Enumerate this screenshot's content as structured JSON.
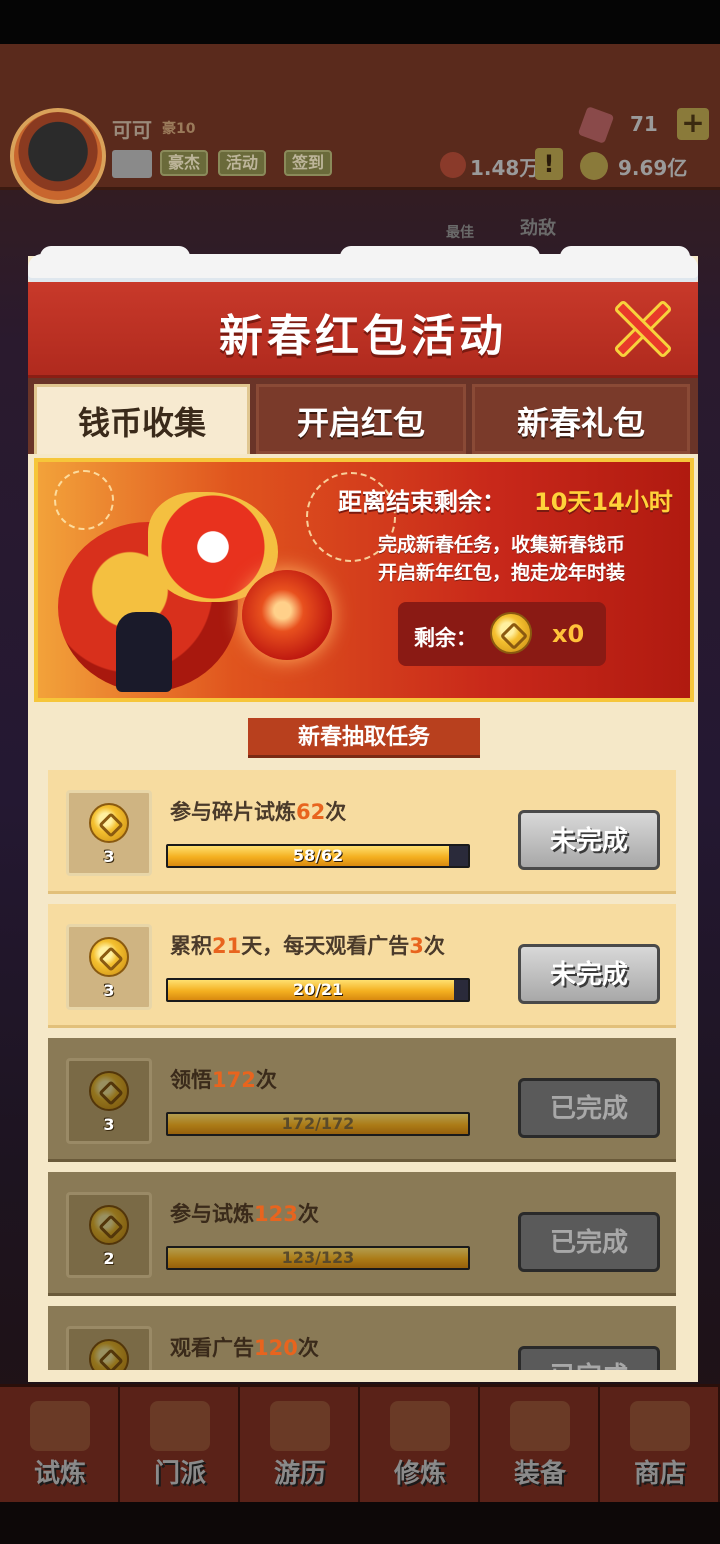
{
  "background": {
    "player": {
      "name": "可可",
      "rank": "豪10"
    },
    "hud_buttons": [
      "豪杰",
      "活动",
      "签到"
    ],
    "gems": "71",
    "resource_1": "1.48万",
    "resource_2": "9.69亿",
    "label_best": "最佳",
    "label_enemy": "劲敌",
    "nav": [
      {
        "label": "试炼",
        "icon": "scroll-icon"
      },
      {
        "label": "门派",
        "icon": "temple-icon"
      },
      {
        "label": "游历",
        "icon": "mountain-icon"
      },
      {
        "label": "修炼",
        "icon": "book-icon"
      },
      {
        "label": "装备",
        "icon": "sword-icon"
      },
      {
        "label": "商店",
        "icon": "shop-icon"
      }
    ]
  },
  "modal": {
    "title": "新春红包活动",
    "tabs": [
      {
        "label": "钱币收集",
        "active": true
      },
      {
        "label": "开启红包",
        "active": false
      },
      {
        "label": "新春礼包",
        "active": false
      }
    ],
    "banner": {
      "timer_label": "距离结束剩余：",
      "timer_value": "10天14小时",
      "desc_line1": "完成新春任务，收集新春钱币",
      "desc_line2": "开启新年红包，抱走龙年时装",
      "remain_label": "剩余：",
      "remain_count": "x0"
    },
    "section_title": "新春抽取任务",
    "tasks": [
      {
        "pre": "参与碎片试炼",
        "num": "62",
        "post": "次",
        "reward": "3",
        "progress": "58/62",
        "fraction": 0.935,
        "status": "未完成",
        "done": false
      },
      {
        "pre": "累积",
        "num": "21",
        "post": "天，每天观看广告",
        "num2": "3",
        "post2": "次",
        "reward": "3",
        "progress": "20/21",
        "fraction": 0.952,
        "status": "未完成",
        "done": false
      },
      {
        "pre": "领悟",
        "num": "172",
        "post": "次",
        "reward": "3",
        "progress": "172/172",
        "fraction": 1.0,
        "status": "已完成",
        "done": true
      },
      {
        "pre": "参与试炼",
        "num": "123",
        "post": "次",
        "reward": "2",
        "progress": "123/123",
        "fraction": 1.0,
        "status": "已完成",
        "done": true
      },
      {
        "pre": "观看广告",
        "num": "120",
        "post": "次",
        "reward": "",
        "progress": "",
        "fraction": 1.0,
        "status": "已完成",
        "done": true
      }
    ]
  }
}
